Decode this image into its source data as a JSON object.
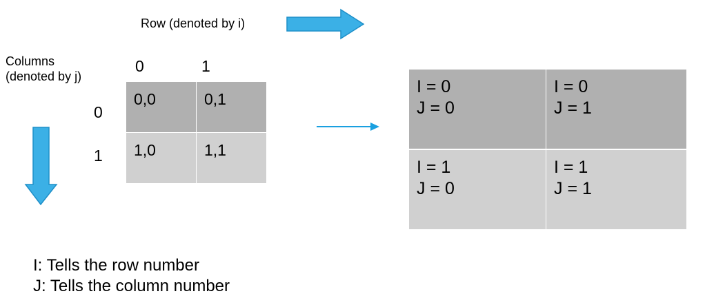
{
  "row_label": "Row (denoted by i)",
  "columns_label": "Columns (denoted by j)",
  "column_indices": [
    "0",
    "1"
  ],
  "row_indices": [
    "0",
    "1"
  ],
  "small_grid": [
    [
      "0,0",
      "0,1"
    ],
    [
      "1,0",
      "1,1"
    ]
  ],
  "big_grid": [
    [
      {
        "i": "I = 0",
        "j": "J = 0"
      },
      {
        "i": "I = 0",
        "j": "J = 1"
      }
    ],
    [
      {
        "i": "I = 1",
        "j": "J = 0"
      },
      {
        "i": "I = 1",
        "j": "J = 1"
      }
    ]
  ],
  "legend": {
    "i_line": "I: Tells the row number",
    "j_line": "J: Tells the column number"
  },
  "colors": {
    "arrow_fill": "#3bb0e6",
    "arrow_stroke": "#1e8fc8",
    "dark_cell": "#b0b0b0",
    "light_cell": "#d0d0d0"
  },
  "icons": [
    "arrow-right-icon",
    "arrow-down-icon",
    "thin-arrow-right-icon"
  ]
}
